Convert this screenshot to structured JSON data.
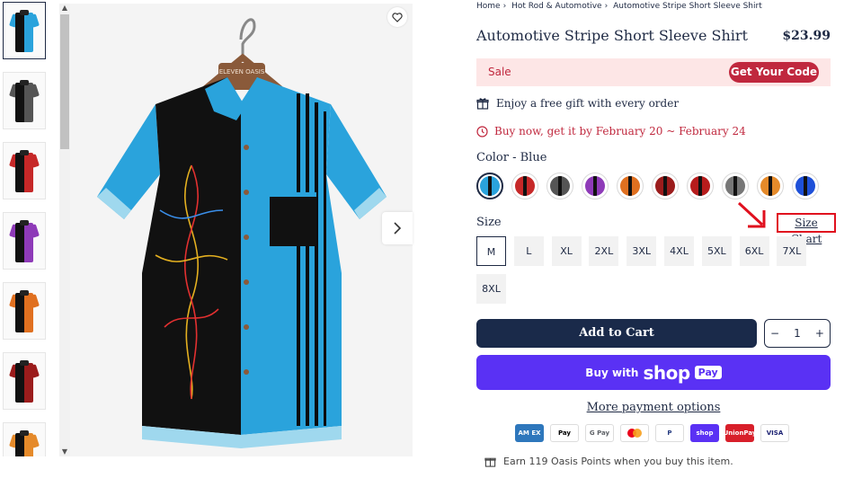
{
  "breadcrumb": [
    "Home",
    "Hot Rod & Automotive",
    "Automotive Stripe Short Sleeve Shirt"
  ],
  "product": {
    "title": "Automotive Stripe Short Sleeve Shirt",
    "price": "$23.99"
  },
  "sale": {
    "label": "Sale",
    "button": "Get Your Code"
  },
  "perks": {
    "gift": "Enjoy a free gift with every order",
    "shipping": "Buy now, get it by February 20 ~ February 24"
  },
  "color": {
    "label": "Color - Blue"
  },
  "swatches": [
    {
      "color": "#2aa3dc",
      "accent": "#111111"
    },
    {
      "color": "#c62828",
      "accent": "#111111"
    },
    {
      "color": "#555555",
      "accent": "#111111"
    },
    {
      "color": "#8e3ab8",
      "accent": "#111111"
    },
    {
      "color": "#e07020",
      "accent": "#111111"
    },
    {
      "color": "#9b1c1c",
      "accent": "#111111"
    },
    {
      "color": "#b71c1c",
      "accent": "#111111"
    },
    {
      "color": "#777777",
      "accent": "#111111"
    },
    {
      "color": "#e58a2a",
      "accent": "#111111"
    },
    {
      "color": "#1e50d8",
      "accent": "#111111"
    }
  ],
  "size": {
    "label": "Size",
    "chart_link": "Size Chart",
    "options": [
      "M",
      "L",
      "XL",
      "2XL",
      "3XL",
      "4XL",
      "5XL",
      "6XL",
      "7XL",
      "8XL"
    ],
    "selected": "M"
  },
  "cart": {
    "add_label": "Add to Cart",
    "qty": "1",
    "minus": "−",
    "plus": "+"
  },
  "shoppay": {
    "buy": "Buy with",
    "shop": "shop",
    "pay": "Pay"
  },
  "more_payment": "More payment options",
  "payment_icons": [
    {
      "name": "amex-icon",
      "label": "AM EX",
      "bg": "#2e77bc",
      "fg": "#ffffff"
    },
    {
      "name": "apple-pay-icon",
      "label": "Pay",
      "bg": "#ffffff",
      "fg": "#000000"
    },
    {
      "name": "google-pay-icon",
      "label": "G Pay",
      "bg": "#ffffff",
      "fg": "#5f6368"
    },
    {
      "name": "mastercard-icon",
      "label": "",
      "bg": "#ffffff",
      "fg": "#000000"
    },
    {
      "name": "paypal-icon",
      "label": "P",
      "bg": "#ffffff",
      "fg": "#253b80"
    },
    {
      "name": "shop-pay-icon",
      "label": "shop",
      "bg": "#5a31f4",
      "fg": "#ffffff"
    },
    {
      "name": "unionpay-icon",
      "label": "UnionPay",
      "bg": "#d81f2a",
      "fg": "#ffffff"
    },
    {
      "name": "visa-icon",
      "label": "VISA",
      "bg": "#ffffff",
      "fg": "#1a1f71"
    }
  ],
  "points": "Earn 119 Oasis Points when you buy this item.",
  "hanger_label": "ELEVEN OASIS",
  "thumbnails": [
    {
      "main": "#2aa3dc"
    },
    {
      "main": "#555555"
    },
    {
      "main": "#c62828"
    },
    {
      "main": "#8e3ab8"
    },
    {
      "main": "#e07020"
    },
    {
      "main": "#9b1c1c"
    },
    {
      "main": "#e58a2a"
    }
  ]
}
